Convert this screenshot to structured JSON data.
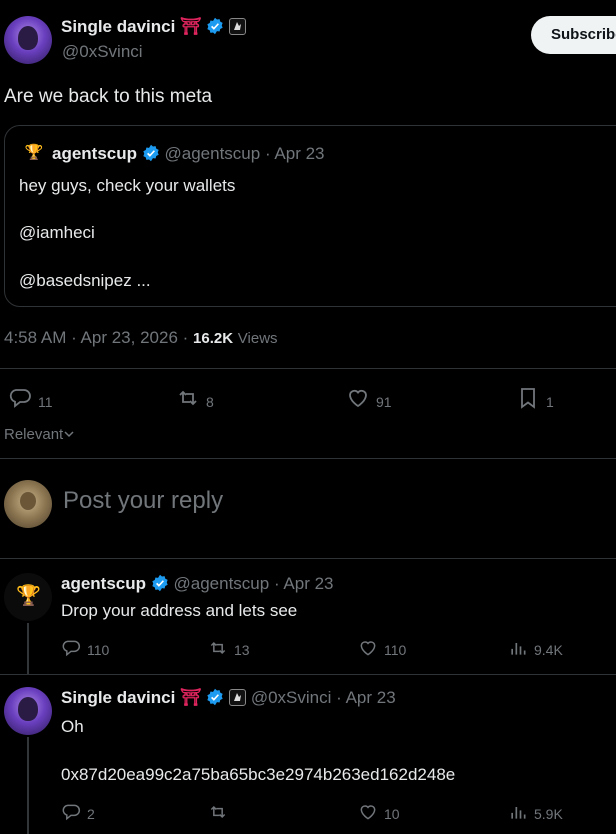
{
  "main_post": {
    "display_name": "Single davinci",
    "torii": "⛩",
    "handle": "@0xSvinci",
    "subscribe_label": "Subscribe",
    "text": "Are we back to this meta",
    "timestamp": "4:58 AM · Apr 23, 2026 · ",
    "views_count": "16.2K",
    "views_label": "Views",
    "stats": {
      "replies": "11",
      "reposts": "8",
      "likes": "91",
      "bookmarks": "1"
    }
  },
  "quoted": {
    "display_name": "agentscup",
    "handle": "@agentscup",
    "date": "· Apr 23",
    "lines": [
      "hey guys, check your wallets",
      "@iamheci",
      "@basedsnipez ..."
    ]
  },
  "sort": {
    "label": "Relevant"
  },
  "reply_box": {
    "placeholder": "Post your reply"
  },
  "replies": [
    {
      "display_name": "agentscup",
      "handle": "@agentscup",
      "date": "· Apr 23",
      "text": "Drop your address and lets see",
      "stats": {
        "replies": "110",
        "reposts": "13",
        "likes": "110",
        "views": "9.4K"
      }
    },
    {
      "display_name": "Single davinci",
      "torii": "⛩",
      "handle": "@0xSvinci",
      "date": "· Apr 23",
      "text1": "Oh",
      "text2": "0x87d20ea99c2a75ba65bc3e2974b263ed162d248e",
      "stats": {
        "replies": "2",
        "reposts": "",
        "likes": "10",
        "views": "5.9K"
      }
    }
  ],
  "colors": {
    "accent": "#1d9bf0",
    "muted": "#71767b",
    "border": "#2f3336",
    "torii": "#e0245e"
  }
}
